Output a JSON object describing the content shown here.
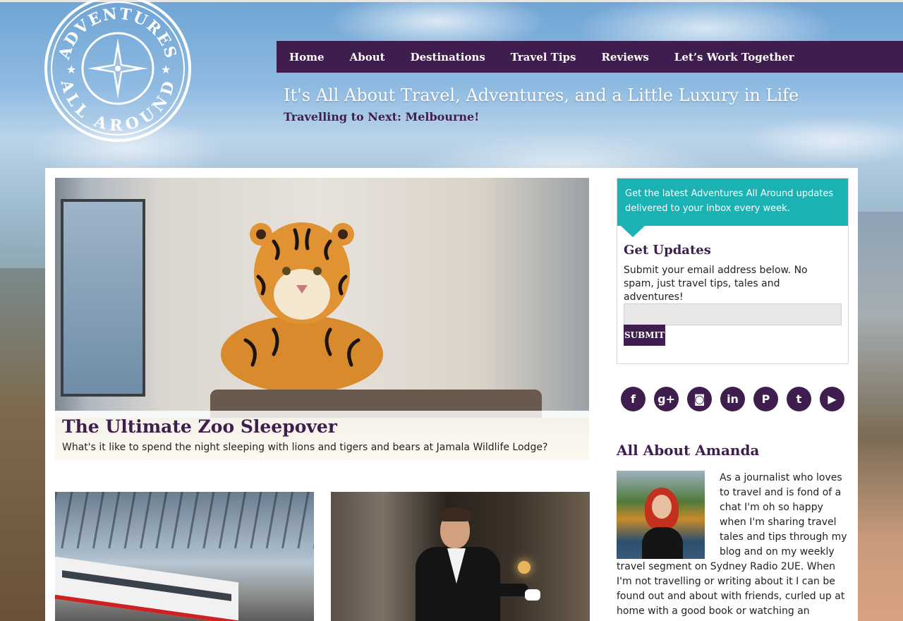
{
  "site": {
    "logo_text_top": "ADVENTURES",
    "logo_text_bottom": "ALL AROUND",
    "tagline": "It's All About Travel, Adventures, and a Little Luxury in Life",
    "next_trip": "Travelling to Next: Melbourne!"
  },
  "nav": {
    "items": [
      {
        "label": "Home"
      },
      {
        "label": "About"
      },
      {
        "label": "Destinations"
      },
      {
        "label": "Travel Tips"
      },
      {
        "label": "Reviews"
      },
      {
        "label": "Let’s Work Together"
      }
    ]
  },
  "featured": {
    "title": "The Ultimate Zoo Sleepover",
    "excerpt": "What's it like to spend the night sleeping with lions and tigers and bears at Jamala Wildlife Lodge?"
  },
  "signup": {
    "banner": "Get the latest Adventures All Around updates delivered to your inbox every week.",
    "title": "Get Updates",
    "description": "Submit your email address below. No spam, just travel tips, tales and adventures!",
    "input_placeholder": "",
    "submit_label": "SUBMIT"
  },
  "social": {
    "icons": [
      {
        "name": "facebook-icon",
        "glyph": "f"
      },
      {
        "name": "google-plus-icon",
        "glyph": "g+"
      },
      {
        "name": "instagram-icon",
        "glyph": "◙"
      },
      {
        "name": "linkedin-icon",
        "glyph": "in"
      },
      {
        "name": "pinterest-icon",
        "glyph": "P"
      },
      {
        "name": "twitter-icon",
        "glyph": "t"
      },
      {
        "name": "youtube-icon",
        "glyph": "▶"
      }
    ]
  },
  "about": {
    "title": "All About Amanda",
    "text": "As a journalist who loves to travel and is fond of a chat I'm oh so happy when I'm sharing travel tales and tips through my blog and on my weekly travel segment on Sydney Radio 2UE. When I'm not travelling or writing about it I can be found out and about with friends, curled up at home with a good book or watching an addictive tv show"
  },
  "colors": {
    "brand_purple": "#3f1d4f",
    "accent_teal": "#1ab2b2"
  }
}
